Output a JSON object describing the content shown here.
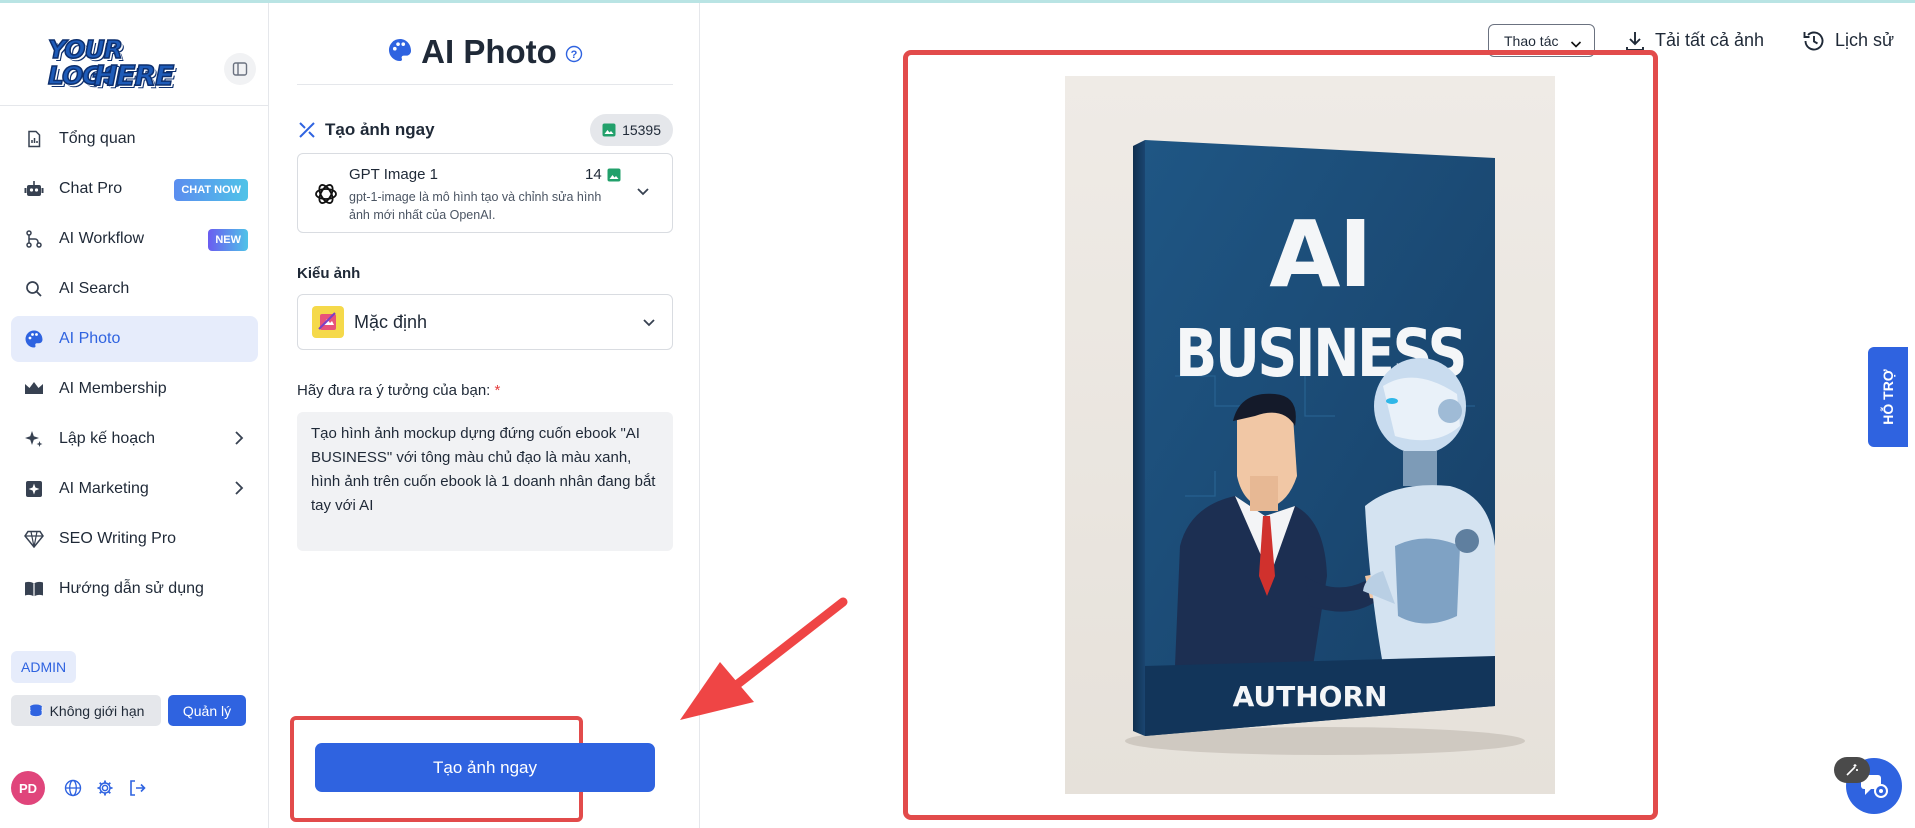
{
  "logo": {
    "line1": "YOUR LOGO",
    "line2": "HERE"
  },
  "sidebar": {
    "items": [
      {
        "label": "Tổng quan",
        "icon": "report-icon"
      },
      {
        "label": "Chat Pro",
        "icon": "robot-icon",
        "badge": "CHAT NOW"
      },
      {
        "label": "AI Workflow",
        "icon": "workflow-icon",
        "badge": "NEW"
      },
      {
        "label": "AI Search",
        "icon": "search-icon"
      },
      {
        "label": "AI Photo",
        "icon": "palette-icon",
        "active": true
      },
      {
        "label": "AI Membership",
        "icon": "crown-icon"
      },
      {
        "label": "Lập kế hoạch",
        "icon": "sparkle-icon"
      },
      {
        "label": "AI Marketing",
        "icon": "marketing-icon"
      },
      {
        "label": "SEO Writing Pro",
        "icon": "diamond-icon"
      },
      {
        "label": "Hướng dẫn sử dụng",
        "icon": "book-icon"
      }
    ],
    "admin_label": "ADMIN",
    "unlimited_label": "Không giới hạn",
    "manage_label": "Quản lý",
    "avatar_initials": "PD"
  },
  "panel": {
    "title": "AI Photo",
    "create_title": "Tạo ảnh ngay",
    "credits": "15395",
    "model": {
      "name": "GPT Image 1",
      "cost": "14",
      "description": "gpt-1-image là mô hình tạo và chỉnh sửa hình ảnh mới nhất của OpenAI."
    },
    "style_label": "Kiểu ảnh",
    "style_value": "Mặc định",
    "prompt_label": "Hãy đưa ra ý tưởng của bạn:",
    "prompt_required": "*",
    "prompt_value": "Tạo hình ảnh mockup dựng đứng cuốn ebook \"AI BUSINESS\" với tông màu chủ đạo là màu xanh, hình ảnh trên cuốn ebook là 1 doanh nhân đang bắt tay với AI",
    "generate_button": "Tạo ảnh ngay"
  },
  "toolbar": {
    "actions_label": "Thao tác",
    "download_all": "Tải tất cả ảnh",
    "history": "Lịch sử"
  },
  "generated_image": {
    "title_line1": "AI",
    "title_line2": "BUSINESS",
    "author": "AUTHORN",
    "cover_color": "#1d4a73"
  },
  "support_tab": "HỖ TRỢ",
  "colors": {
    "accent": "#2f63e0",
    "highlight": "#e24b4b",
    "cover": "#1d4a73"
  }
}
